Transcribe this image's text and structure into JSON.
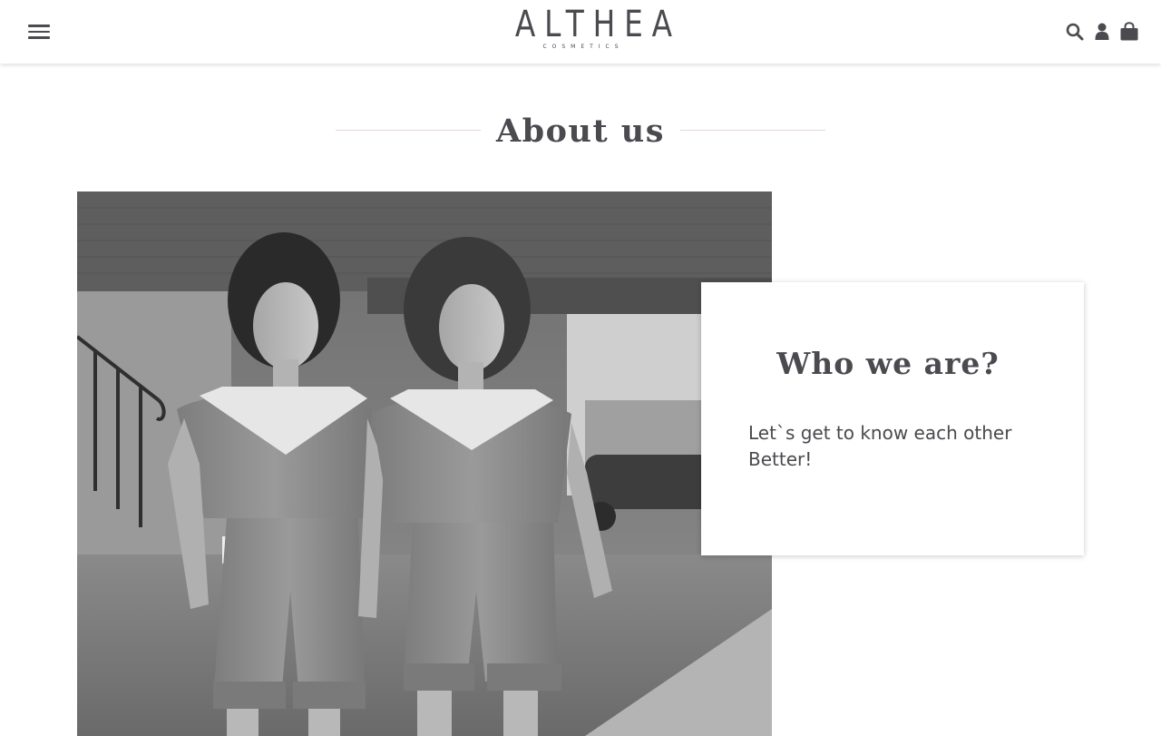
{
  "header": {
    "logo_text": "ALTHEA",
    "logo_subtext": "COSMETICS",
    "menu_icon": "hamburger-menu-icon",
    "icons": [
      "search-icon",
      "user-icon",
      "shopping-bag-icon"
    ]
  },
  "about": {
    "title": "About us"
  },
  "card": {
    "title": "Who we are?",
    "text": "Let`s get to know each other Better!"
  },
  "colors": {
    "text": "#4a4a4f",
    "divider": "#e3d7d9",
    "background": "#ffffff"
  }
}
